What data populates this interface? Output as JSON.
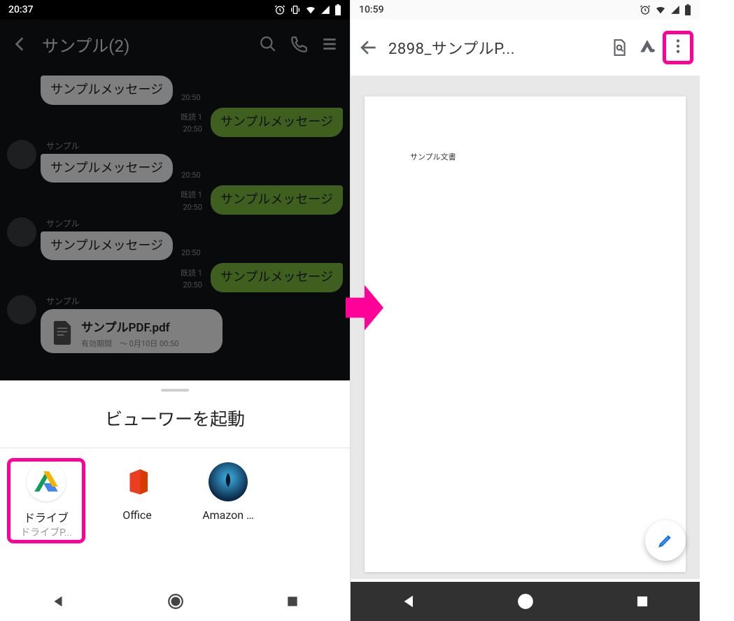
{
  "highlight_color": "#ff0099",
  "left": {
    "status": {
      "time": "20:37"
    },
    "chat": {
      "back_label": "‹",
      "title": "サンプル(2)",
      "messages": [
        {
          "dir": "in",
          "text": "サンプルメッセージ",
          "time": "20:50",
          "sender": ""
        },
        {
          "dir": "out",
          "text": "サンプルメッセージ",
          "time": "20:50",
          "read": "既読 1"
        },
        {
          "dir": "in",
          "text": "サンプルメッセージ",
          "time": "20:50",
          "sender": "サンプル"
        },
        {
          "dir": "out",
          "text": "サンプルメッセージ",
          "time": "20:50",
          "read": "既読 1"
        },
        {
          "dir": "in",
          "text": "サンプルメッセージ",
          "time": "20:50",
          "sender": "サンプル"
        },
        {
          "dir": "out",
          "text": "サンプルメッセージ",
          "time": "20:50",
          "read": "既読 1"
        }
      ],
      "file": {
        "sender": "サンプル",
        "name": "サンプルPDF.pdf",
        "sub": "有効期間　〜 0月10日 00:50"
      }
    },
    "sheet": {
      "title": "ビューワーを起動",
      "apps": [
        {
          "label": "ドライブ",
          "sub": "ドライブP...",
          "highlight": true,
          "icon": "drive"
        },
        {
          "label": "Office",
          "sub": "",
          "highlight": false,
          "icon": "office"
        },
        {
          "label": "Amazon …",
          "sub": "",
          "highlight": false,
          "icon": "kindle"
        }
      ]
    }
  },
  "right": {
    "status": {
      "time": "10:59"
    },
    "drive": {
      "title": "2898_サンプルP...",
      "page_text": "サンプル文書"
    }
  }
}
